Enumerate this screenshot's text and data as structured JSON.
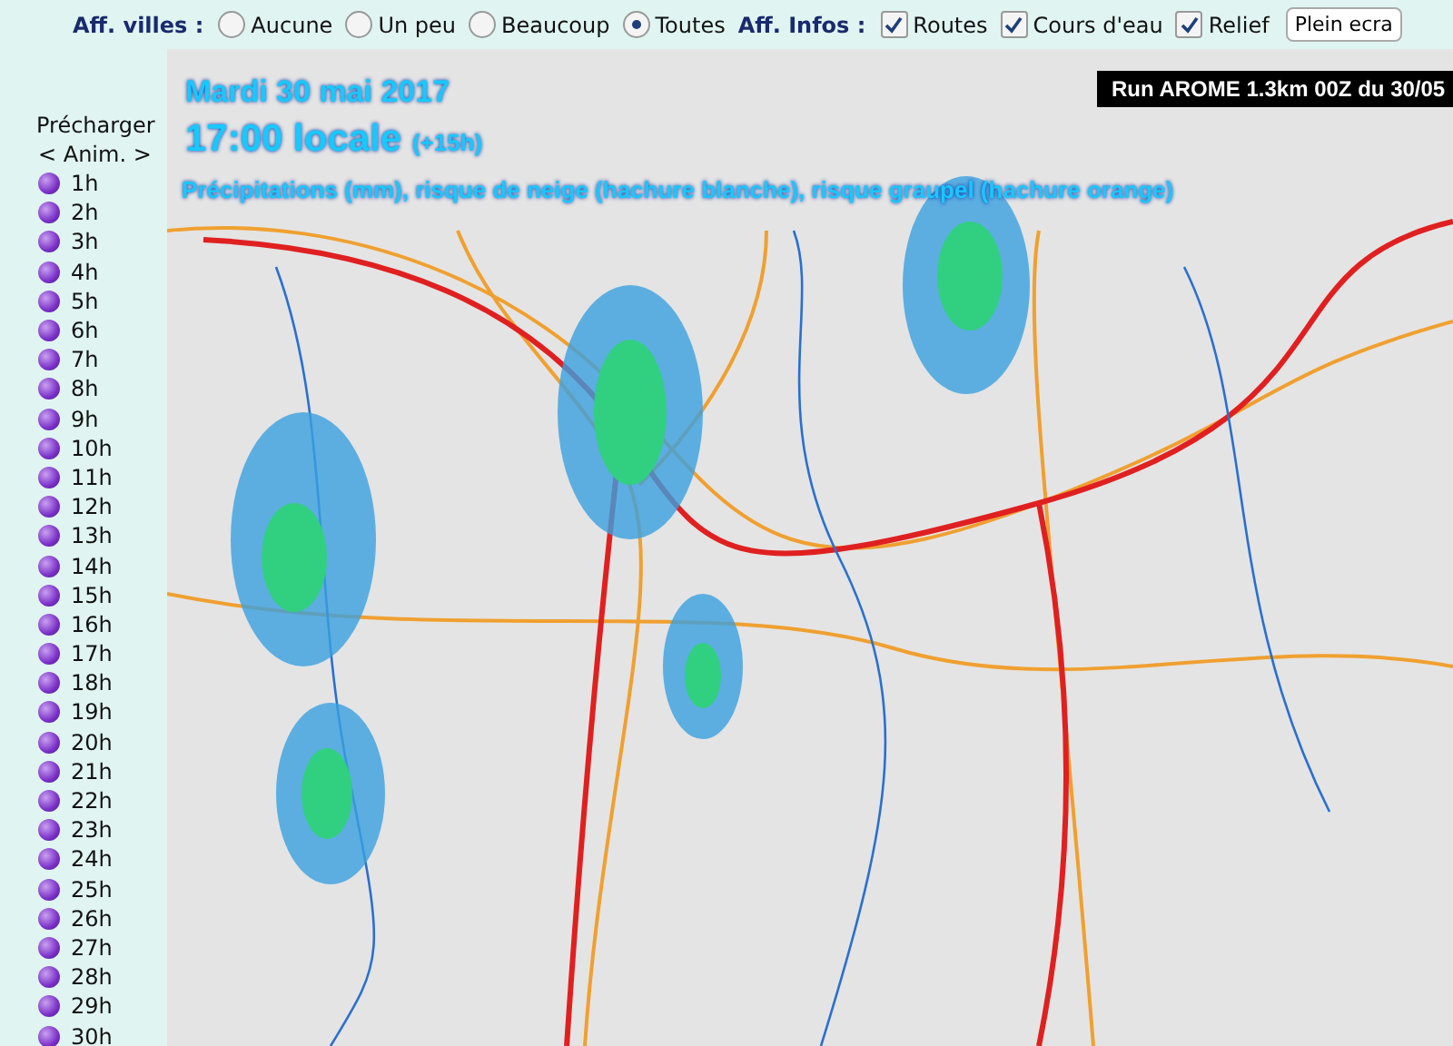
{
  "toolbar": {
    "cities_label": "Aff. villes :",
    "city_options": [
      {
        "label": "Aucune",
        "selected": false
      },
      {
        "label": "Un peu",
        "selected": false
      },
      {
        "label": "Beaucoup",
        "selected": false
      },
      {
        "label": "Toutes",
        "selected": true
      }
    ],
    "info_label": "Aff. Infos :",
    "info_options": [
      {
        "label": "Routes",
        "checked": true
      },
      {
        "label": "Cours d'eau",
        "checked": true
      },
      {
        "label": "Relief",
        "checked": true
      }
    ],
    "fullscreen_button": "Plein ecra"
  },
  "sidebar": {
    "preload_label": "Précharger",
    "anim_label": "< Anim. >",
    "hours": [
      "1h",
      "2h",
      "3h",
      "4h",
      "5h",
      "6h",
      "7h",
      "8h",
      "9h",
      "10h",
      "11h",
      "12h",
      "13h",
      "14h",
      "15h",
      "16h",
      "17h",
      "18h",
      "19h",
      "20h",
      "21h",
      "22h",
      "23h",
      "24h",
      "25h",
      "26h",
      "27h",
      "28h",
      "29h",
      "30h"
    ]
  },
  "map": {
    "date": "Mardi 30 mai 2017",
    "time": "17:00 locale",
    "offset": "(+15h)",
    "legend": "Précipitations (mm), risque de neige (hachure blanche), risque graupel (hachure orange)",
    "run_label": "Run AROME 1.3km 00Z du 30/05"
  }
}
